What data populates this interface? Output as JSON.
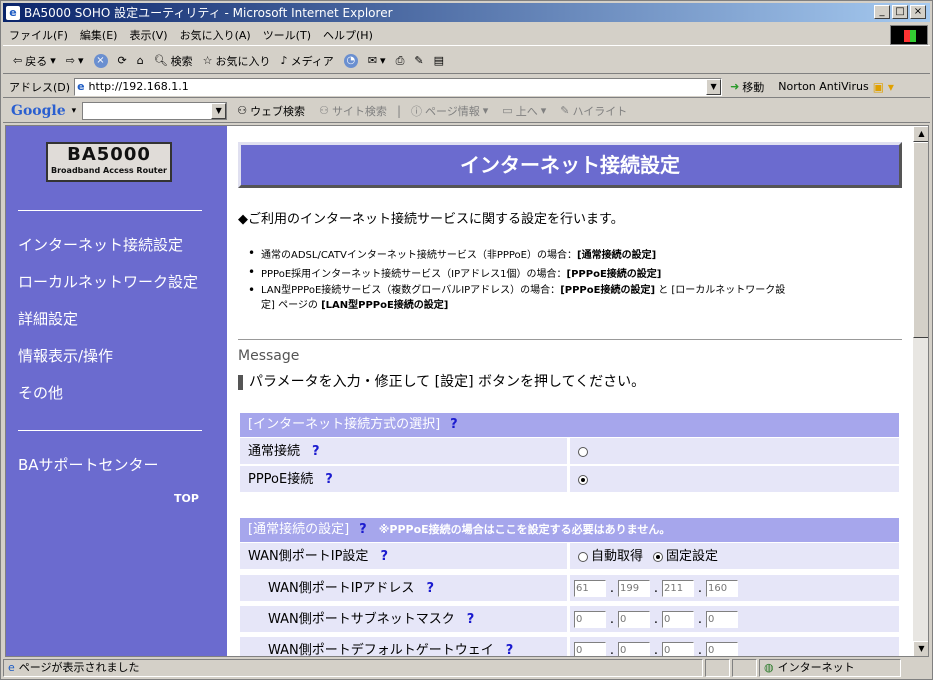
{
  "window": {
    "title": "BA5000 SOHO 設定ユーティリティ - Microsoft Internet Explorer",
    "buttons": [
      "_",
      "□",
      "×"
    ]
  },
  "menu": [
    "ファイル(F)",
    "編集(E)",
    "表示(V)",
    "お気に入り(A)",
    "ツール(T)",
    "ヘルプ(H)"
  ],
  "toolbar": {
    "back": "戻る",
    "search": "検索",
    "favorites": "お気に入り",
    "media": "メディア"
  },
  "address": {
    "label": "アドレス(D)",
    "url": "http://192.168.1.1",
    "go": "移動",
    "norton": "Norton AntiVirus"
  },
  "google": {
    "logo": "Google",
    "web_search": "ウェブ検索",
    "site_search": "サイト検索",
    "page_info": "ページ情報",
    "up": "上へ",
    "highlight": "ハイライト"
  },
  "sidebar": {
    "logo_main": "BA5000",
    "logo_sub": "Broadband Access Router",
    "items": [
      "インターネット接続設定",
      "ローカルネットワーク設定",
      "詳細設定",
      "情報表示/操作",
      "その他"
    ],
    "support": "BAサポートセンター",
    "top": "TOP"
  },
  "main": {
    "header": "インターネット接続設定",
    "intro": "◆ご利用のインターネット接続サービスに関する設定を行います。",
    "bullets": [
      {
        "text": "通常のADSL/CATVインターネット接続サービス（非PPPoE）の場合：",
        "bold": "[通常接続の設定]"
      },
      {
        "text": "PPPoE採用インターネット接続サービス（IPアドレス1個）の場合：",
        "bold": "[PPPoE接続の設定]"
      },
      {
        "text": "LAN型PPPoE接続サービス（複数グローバルIPアドレス）の場合：",
        "bold": "[PPPoE接続の設定]",
        "text2": " と [ローカルネットワーク設",
        "text3": "定] ページの ",
        "bold2": "[LAN型PPPoE接続の設定]"
      }
    ],
    "message_label": "Message",
    "message_text": "パラメータを入力・修正して [設定] ボタンを押してください。",
    "section1": {
      "title": "[インターネット接続方式の選択]",
      "q": "?"
    },
    "opt_normal": "通常接続",
    "opt_pppoe": "PPPoE接続",
    "section2": {
      "title": "[通常接続の設定]",
      "q": "?",
      "note": "※PPPoE接続の場合はここを設定する必要はありません。"
    },
    "wan_ip": "WAN側ポートIP設定",
    "auto": "自動取得",
    "fixed": "固定設定",
    "wan_addr": "WAN側ポートIPアドレス",
    "ip_values": [
      "61",
      "199",
      "211",
      "160"
    ],
    "wan_mask": "WAN側ポートサブネットマスク",
    "mask_values": [
      "0",
      "0",
      "0",
      "0"
    ],
    "wan_gw": "WAN側ポートデフォルトゲートウェイ",
    "gw_values": [
      "0",
      "0",
      "0",
      "0"
    ],
    "q": "?"
  },
  "status": {
    "text": "ページが表示されました",
    "zone": "インターネット"
  }
}
